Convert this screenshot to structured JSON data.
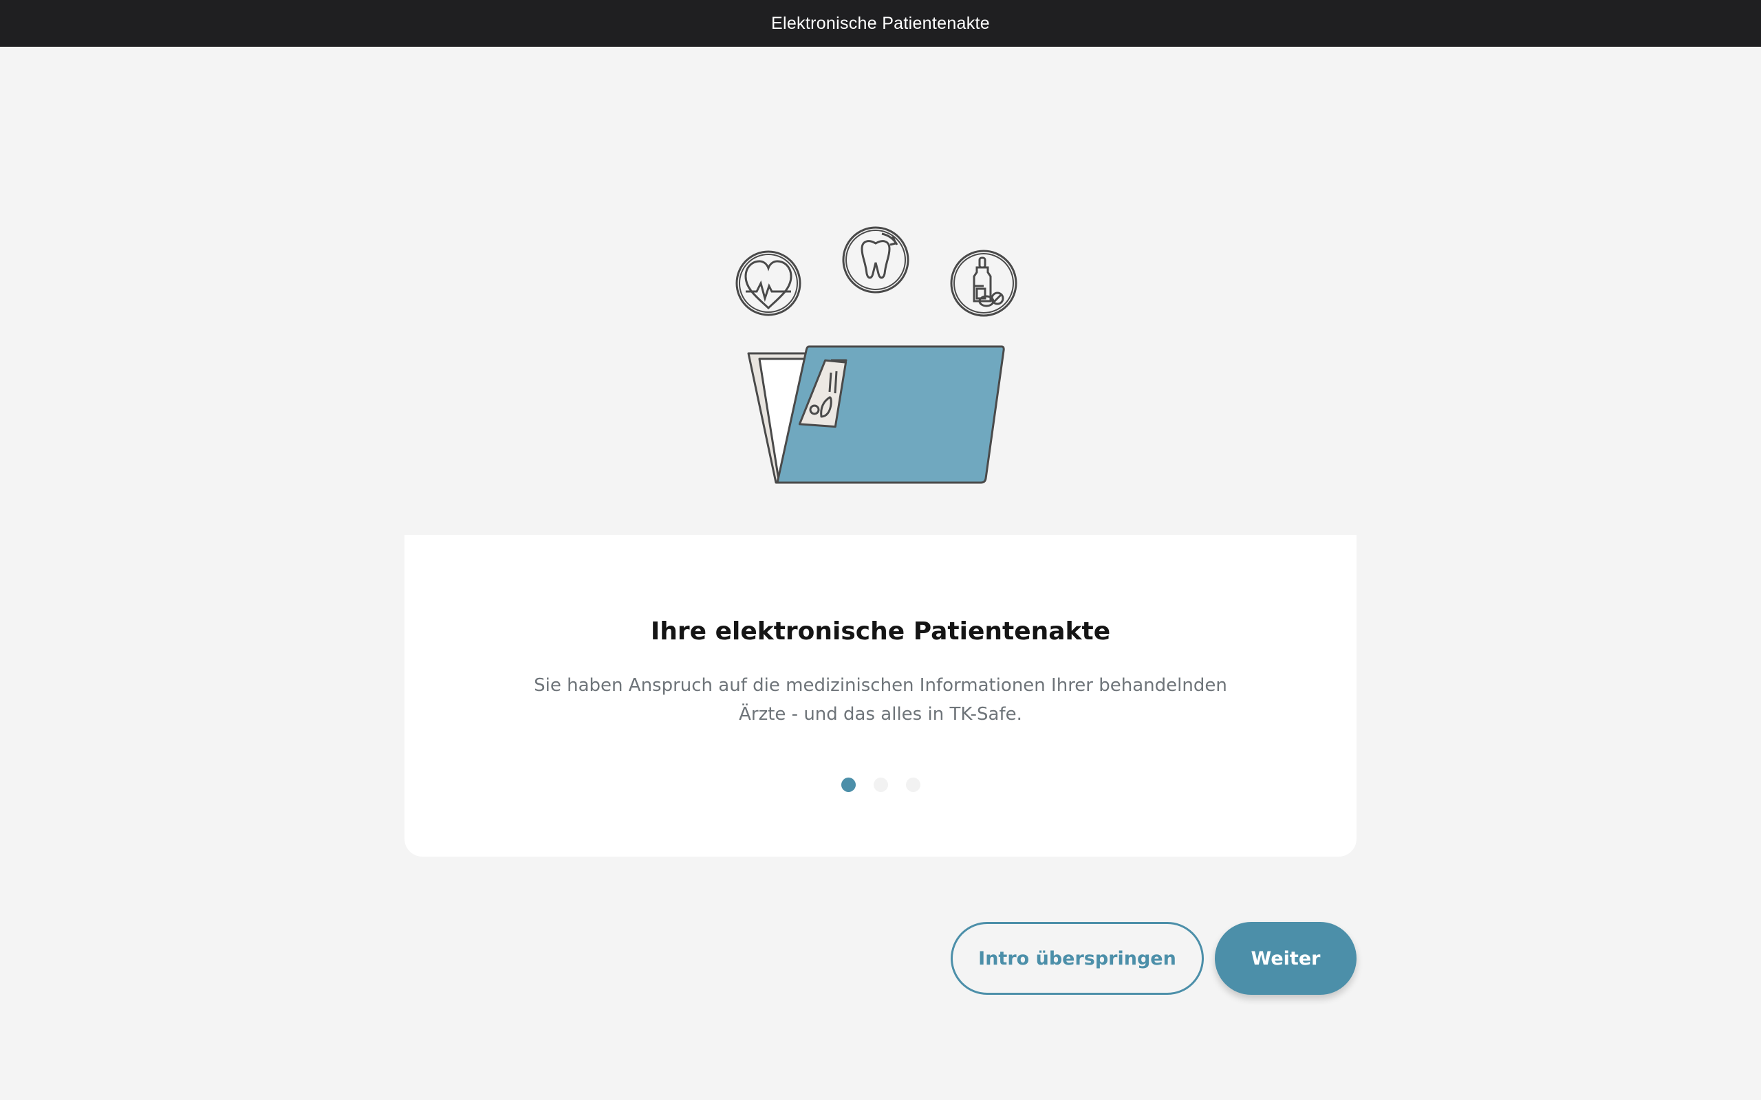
{
  "window": {
    "title": "Elektronische Patientenakte"
  },
  "onboarding": {
    "title": "Ihre elektronische Patientenakte",
    "description": "Sie haben Anspruch auf die medizinischen Informationen Ihrer behandelnden Ärzte - und das alles in TK-Safe.",
    "page_count": 3,
    "current_page": 1
  },
  "actions": {
    "skip_label": "Intro überspringen",
    "next_label": "Weiter"
  },
  "colors": {
    "accent": "#4c8fa9",
    "folder": "#70a8bf",
    "titlebar": "#1f1f21",
    "background": "#f4f4f4"
  },
  "icons": [
    "heart-pulse-icon",
    "tooth-icon",
    "medicine-bottle-icon",
    "folder-icon"
  ]
}
